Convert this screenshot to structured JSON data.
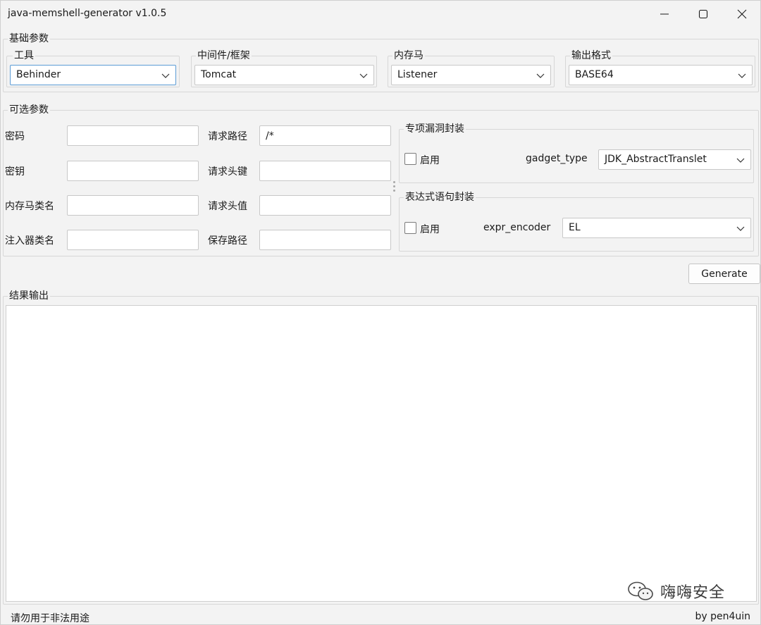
{
  "window": {
    "title": "java-memshell-generator v1.0.5"
  },
  "basic_params": {
    "legend": "基础参数",
    "tool": {
      "label": "工具",
      "value": "Behinder"
    },
    "middleware": {
      "label": "中间件/框架",
      "value": "Tomcat"
    },
    "memshell": {
      "label": "内存马",
      "value": "Listener"
    },
    "output_format": {
      "label": "输出格式",
      "value": "BASE64"
    }
  },
  "optional_params": {
    "legend": "可选参数",
    "password": {
      "label": "密码",
      "value": ""
    },
    "key": {
      "label": "密钥",
      "value": ""
    },
    "shell_class_name": {
      "label": "内存马类名",
      "value": ""
    },
    "injector_class_name": {
      "label": "注入器类名",
      "value": ""
    },
    "request_path": {
      "label": "请求路径",
      "value": "/*"
    },
    "header_key": {
      "label": "请求头键",
      "value": ""
    },
    "header_value": {
      "label": "请求头值",
      "value": ""
    },
    "save_path": {
      "label": "保存路径",
      "value": ""
    }
  },
  "gadget_wrap": {
    "legend": "专项漏洞封装",
    "enable_label": "启用",
    "enabled": false,
    "type_label": "gadget_type",
    "type_value": "JDK_AbstractTranslet"
  },
  "expr_wrap": {
    "legend": "表达式语句封装",
    "enable_label": "启用",
    "enabled": false,
    "encoder_label": "expr_encoder",
    "encoder_value": "EL"
  },
  "generate_label": "Generate",
  "result": {
    "legend": "结果输出",
    "content": ""
  },
  "watermark_text": "嗨嗨安全",
  "status": {
    "left": "请勿用于非法用途",
    "right": "by pen4uin"
  },
  "icons": [
    "minimize-icon",
    "maximize-icon",
    "close-icon",
    "chevron-down-icon",
    "wechat-icon"
  ],
  "colors": {
    "window_bg": "#f3f3f3",
    "focus_border": "#5b9bd5",
    "input_bg": "#ffffff"
  }
}
